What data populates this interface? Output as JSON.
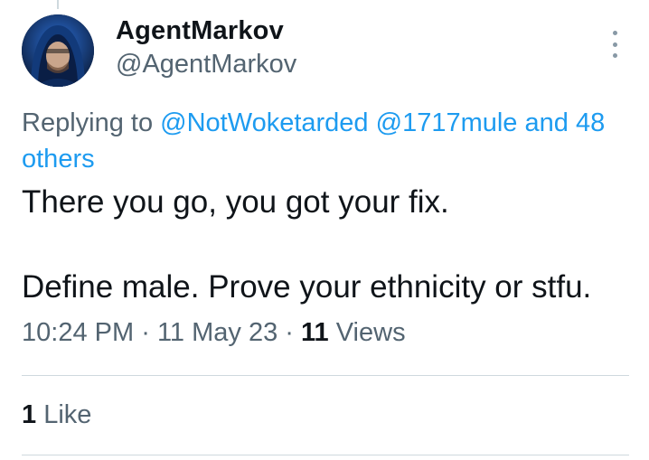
{
  "author": {
    "display_name": "AgentMarkov",
    "handle": "@AgentMarkov",
    "avatar_icon": "hooded-person-avatar"
  },
  "reply_context": {
    "prefix": "Replying to",
    "mentions": [
      "@NotWoketarded",
      "@1717mule"
    ],
    "others": "and 48 others"
  },
  "tweet": {
    "line1": "There you go, you got your fix.",
    "line2": "Define male. Prove your ethnicity or stfu."
  },
  "meta": {
    "time": "10:24 PM",
    "date": "11 May 23",
    "separator": "·",
    "views_count": "11",
    "views_label": "Views"
  },
  "stats": {
    "likes_count": "1",
    "likes_label": "Like"
  },
  "colors": {
    "link": "#1d9bf0",
    "text": "#0f1419",
    "secondary": "#536471",
    "divider": "#cfd9de"
  },
  "more_icon": "more-vertical-icon"
}
